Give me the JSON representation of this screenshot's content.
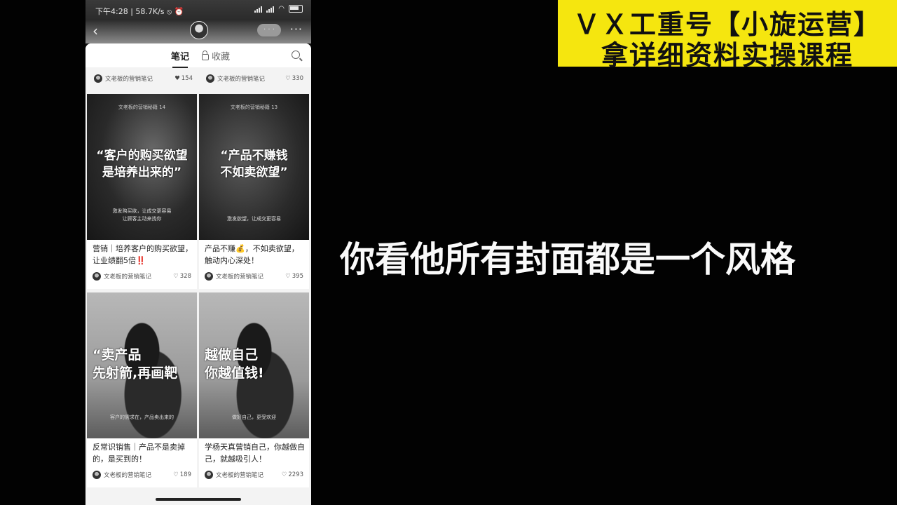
{
  "status_bar": {
    "time": "下午4:28 | 58.7K/s ⦸ ⏰",
    "battery": ""
  },
  "profile_header": {
    "back_icon": "back-chevron-icon",
    "follow_label": "· · ·",
    "more_label": "···"
  },
  "tabs": {
    "notes": "笔记",
    "favorites": "收藏"
  },
  "top_row": [
    {
      "author": "文老板的营销笔记",
      "likes": "154"
    },
    {
      "author": "文老板的营销笔记",
      "likes": "330"
    }
  ],
  "notes": [
    {
      "cover_kicker": "文老板的营销秘籍 14",
      "cover_headline": "“客户的购买欲望\n是培养出来的”",
      "cover_sub": "激发购买欲，让成交更容易\n让顾客主动来找你",
      "title": "营销｜培养客户的购买欲望，让业绩翻5倍‼️",
      "author": "文老板的营销笔记",
      "likes": "328"
    },
    {
      "cover_kicker": "文老板的营销秘籍 13",
      "cover_headline": "“产品不赚钱\n不如卖欲望”",
      "cover_sub": "激发欲望，让成交更容易",
      "title": "产品不赚💰，不如卖欲望，触动内心深处！",
      "author": "文老板的营销笔记",
      "likes": "395"
    },
    {
      "cover_kicker": "",
      "cover_headline": "“卖产品\n先射箭,再画靶",
      "cover_sub": "客户的需求在，产品卖出来的",
      "title": "反常识销售｜产品不是卖掉的，是买到的！",
      "author": "文老板的营销笔记",
      "likes": "189"
    },
    {
      "cover_kicker": "",
      "cover_headline": "越做自己\n你越值钱!",
      "cover_sub": "做好自己，更受欢迎",
      "title": "学杨天真营销自己，你越做自己，就越吸引人！",
      "author": "文老板的营销笔记",
      "likes": "2293"
    }
  ],
  "banner": {
    "line1": "ＶＸ工重号【小旋运营】",
    "line2": "拿详细资料实操课程"
  },
  "caption": "你看他所有封面都是一个风格"
}
